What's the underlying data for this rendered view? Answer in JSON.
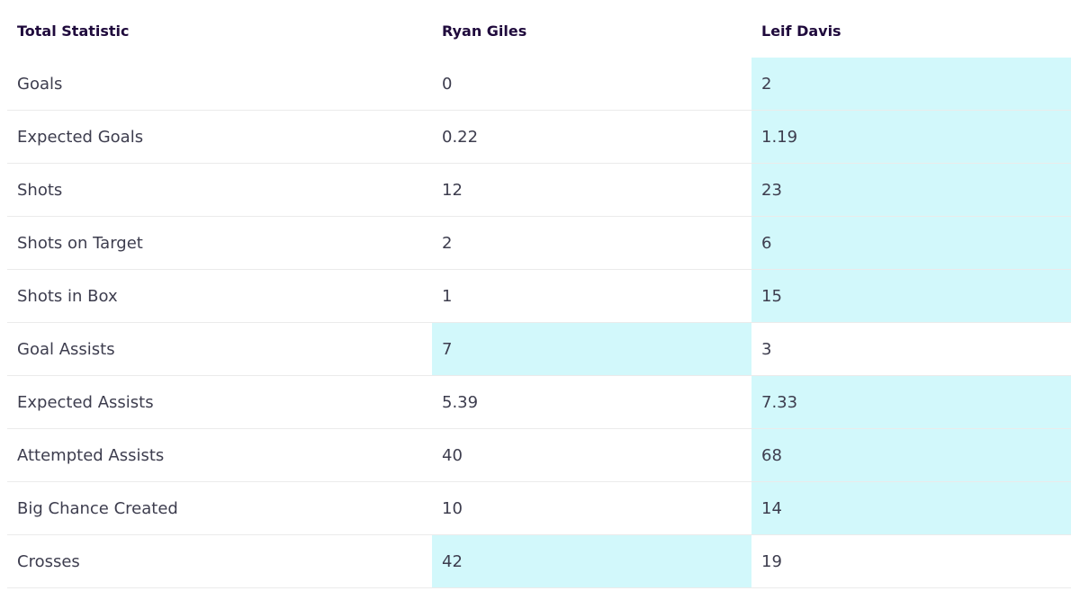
{
  "header": {
    "stat_label": "Total Statistic",
    "player1": "Ryan Giles",
    "player2": "Leif Davis"
  },
  "colors": {
    "highlight": "#d2f8fb",
    "header_text": "#1f0a3c",
    "body_text": "#3d3d4e"
  },
  "rows": [
    {
      "stat": "Goals",
      "p1": "0",
      "p2": "2",
      "leader": "p2"
    },
    {
      "stat": "Expected Goals",
      "p1": "0.22",
      "p2": "1.19",
      "leader": "p2"
    },
    {
      "stat": "Shots",
      "p1": "12",
      "p2": "23",
      "leader": "p2"
    },
    {
      "stat": "Shots on Target",
      "p1": "2",
      "p2": "6",
      "leader": "p2"
    },
    {
      "stat": "Shots in Box",
      "p1": "1",
      "p2": "15",
      "leader": "p2"
    },
    {
      "stat": "Goal Assists",
      "p1": "7",
      "p2": "3",
      "leader": "p1"
    },
    {
      "stat": "Expected Assists",
      "p1": "5.39",
      "p2": "7.33",
      "leader": "p2"
    },
    {
      "stat": "Attempted Assists",
      "p1": "40",
      "p2": "68",
      "leader": "p2"
    },
    {
      "stat": "Big Chance Created",
      "p1": "10",
      "p2": "14",
      "leader": "p2"
    },
    {
      "stat": "Crosses",
      "p1": "42",
      "p2": "19",
      "leader": "p1"
    }
  ]
}
